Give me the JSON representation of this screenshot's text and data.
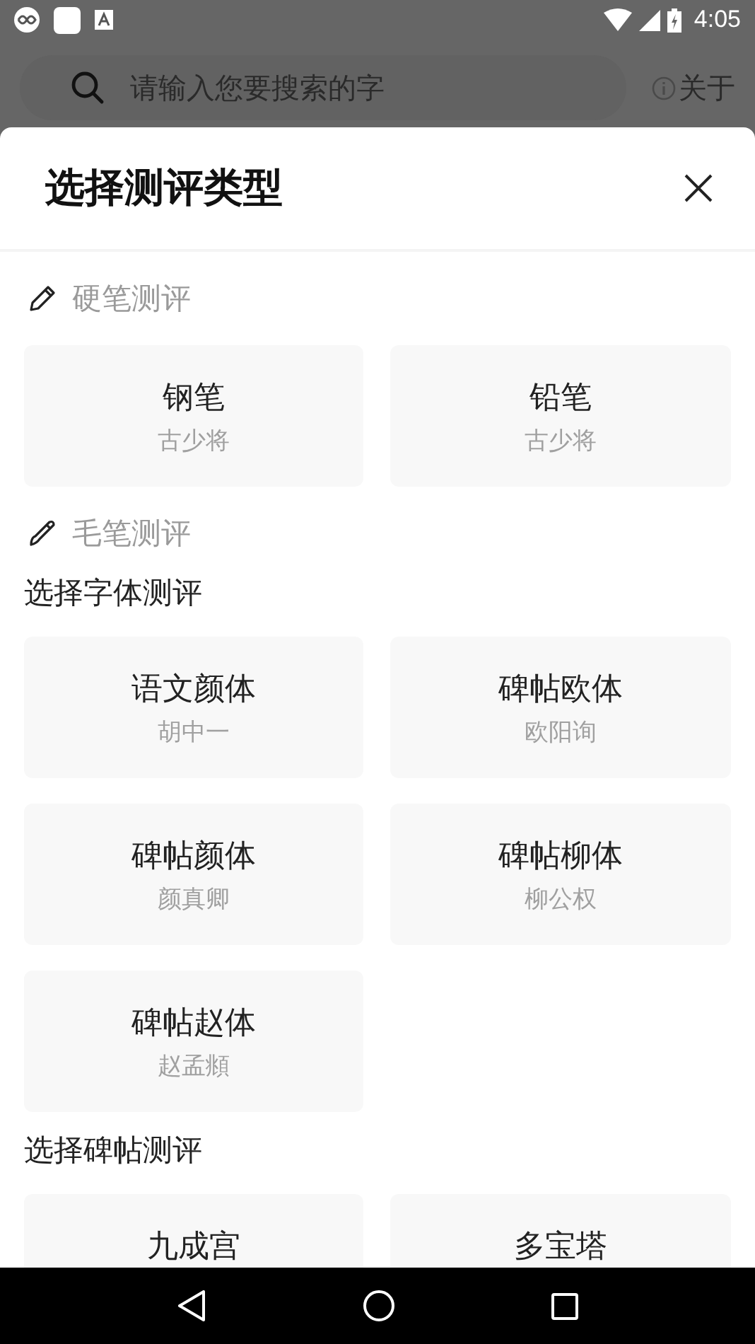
{
  "status_bar": {
    "time": "4:05"
  },
  "search": {
    "placeholder": "请输入您要搜索的字"
  },
  "about_link": "关于",
  "sheet": {
    "title": "选择测评类型",
    "sections": [
      {
        "kind": "pen",
        "title": "硬笔测评",
        "groups": [
          {
            "cards": [
              {
                "name": "钢笔",
                "author": "古少将"
              },
              {
                "name": "铅笔",
                "author": "古少将"
              }
            ]
          }
        ]
      },
      {
        "kind": "brush",
        "title": "毛笔测评",
        "groups": [
          {
            "subtitle": "选择字体测评",
            "cards": [
              {
                "name": "语文颜体",
                "author": "胡中一"
              },
              {
                "name": "碑帖欧体",
                "author": "欧阳询"
              },
              {
                "name": "碑帖颜体",
                "author": "颜真卿"
              },
              {
                "name": "碑帖柳体",
                "author": "柳公权"
              },
              {
                "name": "碑帖赵体",
                "author": "赵孟頫"
              }
            ]
          },
          {
            "subtitle": "选择碑帖测评",
            "cards": [
              {
                "name": "九成宫"
              },
              {
                "name": "多宝塔"
              }
            ]
          }
        ]
      }
    ]
  }
}
